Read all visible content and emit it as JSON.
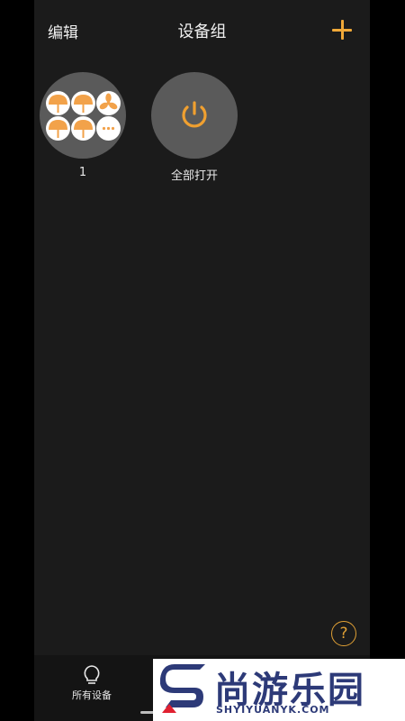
{
  "header": {
    "edit_label": "编辑",
    "title": "设备组"
  },
  "groups": [
    {
      "label": "1",
      "icons": [
        "lamp-icon",
        "lamp-icon",
        "fan-icon",
        "lamp-icon",
        "lamp-icon",
        "more-icon"
      ]
    },
    {
      "label": "全部打开",
      "icon": "power-icon"
    }
  ],
  "tabbar": {
    "all_devices_label": "所有设备"
  },
  "watermark": {
    "text": "尚游乐园",
    "subtext": "SHYIYUANYK.COM"
  },
  "colors": {
    "accent": "#f0a838",
    "background": "#1b1b1b",
    "group_circle": "#5a5a5a",
    "watermark": "#2d3a78"
  }
}
